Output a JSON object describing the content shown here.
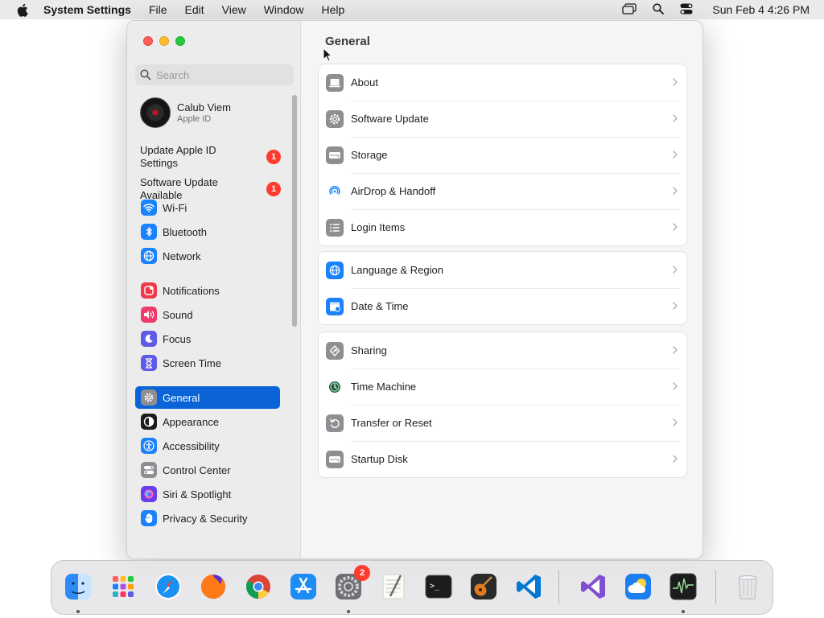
{
  "menubar": {
    "app_name": "System Settings",
    "items": [
      "File",
      "Edit",
      "View",
      "Window",
      "Help"
    ],
    "clock": "Sun Feb 4  4:26 PM"
  },
  "window": {
    "sidebar": {
      "search_placeholder": "Search",
      "profile": {
        "name": "Calub Viem",
        "subtitle": "Apple ID"
      },
      "notices": [
        {
          "text": "Update Apple ID Settings",
          "badge": "1"
        },
        {
          "text": "Software Update Available",
          "badge": "1"
        }
      ],
      "items": [
        {
          "label": "Wi-Fi",
          "icon": "wifi-icon",
          "color": "#1a82fb"
        },
        {
          "label": "Bluetooth",
          "icon": "bluetooth-icon",
          "color": "#1a82fb"
        },
        {
          "label": "Network",
          "icon": "globe-icon",
          "color": "#1a82fb"
        },
        {
          "label": "Notifications",
          "icon": "bell-icon",
          "color": "#f2384a"
        },
        {
          "label": "Sound",
          "icon": "speaker-icon",
          "color": "#f23a6a"
        },
        {
          "label": "Focus",
          "icon": "moon-icon",
          "color": "#5e5ce6"
        },
        {
          "label": "Screen Time",
          "icon": "hourglass-icon",
          "color": "#5e5ce6"
        },
        {
          "label": "General",
          "icon": "gear-icon",
          "color": "#8e8e93",
          "active": true
        },
        {
          "label": "Appearance",
          "icon": "appearance-icon",
          "color": "#1c1c1e"
        },
        {
          "label": "Accessibility",
          "icon": "accessibility-icon",
          "color": "#1a82fb"
        },
        {
          "label": "Control Center",
          "icon": "toggles-icon",
          "color": "#8e8e93"
        },
        {
          "label": "Siri & Spotlight",
          "icon": "siri-icon",
          "color": "#6a3df0"
        },
        {
          "label": "Privacy & Security",
          "icon": "hand-icon",
          "color": "#1a82fb"
        }
      ]
    },
    "content": {
      "title": "General",
      "groups": [
        [
          {
            "label": "About",
            "icon": "laptop-icon",
            "color": "#8e8e93"
          },
          {
            "label": "Software Update",
            "icon": "gear-badge-icon",
            "color": "#8e8e93"
          },
          {
            "label": "Storage",
            "icon": "drive-icon",
            "color": "#8e8e93"
          },
          {
            "label": "AirDrop & Handoff",
            "icon": "airdrop-icon",
            "color": "#ffffff"
          },
          {
            "label": "Login Items",
            "icon": "list-icon",
            "color": "#8e8e93"
          }
        ],
        [
          {
            "label": "Language & Region",
            "icon": "globe-icon",
            "color": "#1a82fb"
          },
          {
            "label": "Date & Time",
            "icon": "calendar-clock-icon",
            "color": "#1a82fb"
          }
        ],
        [
          {
            "label": "Sharing",
            "icon": "sharing-icon",
            "color": "#8e8e93"
          },
          {
            "label": "Time Machine",
            "icon": "time-machine-icon",
            "color": "#ffffff"
          },
          {
            "label": "Transfer or Reset",
            "icon": "reset-icon",
            "color": "#8e8e93"
          },
          {
            "label": "Startup Disk",
            "icon": "drive-icon",
            "color": "#8e8e93"
          }
        ]
      ]
    }
  },
  "dock": {
    "apps": [
      {
        "name": "Finder",
        "icon": "finder-icon",
        "color": "#2f8af5"
      },
      {
        "name": "Launchpad",
        "icon": "launchpad-icon",
        "color": "#e9e9ee"
      },
      {
        "name": "Safari",
        "icon": "safari-icon",
        "color": "#1a90f0"
      },
      {
        "name": "Firefox",
        "icon": "firefox-icon",
        "color": "#ff7a17"
      },
      {
        "name": "Chrome",
        "icon": "chrome-icon",
        "color": "#ffffff"
      },
      {
        "name": "App Store",
        "icon": "appstore-icon",
        "color": "#1d8cf5"
      },
      {
        "name": "System Settings",
        "icon": "settings-icon",
        "color": "#8e8e93",
        "badge": "2"
      },
      {
        "name": "TextEdit",
        "icon": "textedit-icon",
        "color": "#f7f7f2"
      },
      {
        "name": "Terminal",
        "icon": "terminal-icon",
        "color": "#1c1c1e"
      },
      {
        "name": "GarageBand",
        "icon": "guitar-icon",
        "color": "#2a2a2a"
      },
      {
        "name": "VS Code",
        "icon": "vscode-icon",
        "color": "#ffffff"
      },
      {
        "name": "Visual Studio",
        "icon": "visualstudio-icon",
        "color": "#ffffff"
      },
      {
        "name": "Weather",
        "icon": "weather-icon",
        "color": "#1d7ef0"
      },
      {
        "name": "Activity Monitor",
        "icon": "activity-icon",
        "color": "#1c1c1e"
      },
      {
        "name": "Trash",
        "icon": "trash-icon",
        "color": "#e6e6e8"
      }
    ],
    "terminal_prompt": ">_"
  }
}
